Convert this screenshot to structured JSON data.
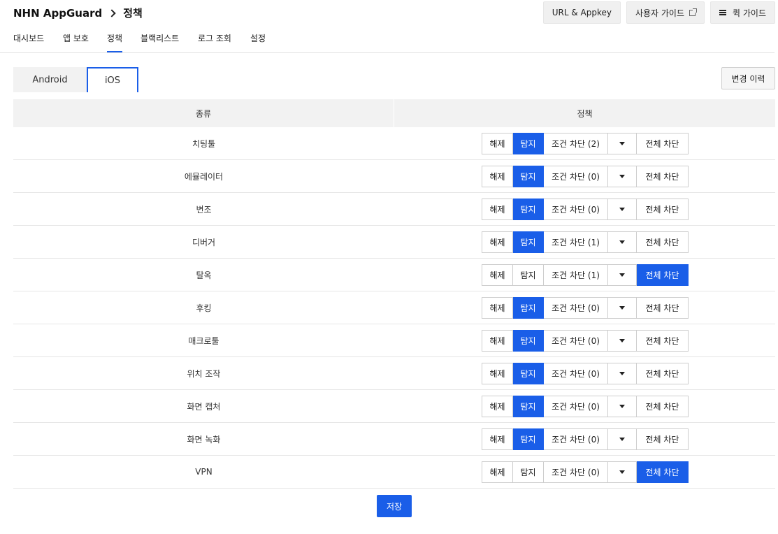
{
  "breadcrumb": {
    "app": "NHN AppGuard",
    "page": "정책"
  },
  "top_buttons": {
    "url_appkey": "URL & Appkey",
    "user_guide": "사용자 가이드",
    "quick_guide": "퀵 가이드"
  },
  "nav_tabs": [
    {
      "label": "대시보드",
      "active": false
    },
    {
      "label": "앱 보호",
      "active": false
    },
    {
      "label": "정책",
      "active": true
    },
    {
      "label": "블랙리스트",
      "active": false
    },
    {
      "label": "로그 조회",
      "active": false
    },
    {
      "label": "설정",
      "active": false
    }
  ],
  "os_tabs": [
    {
      "label": "Android",
      "active": false
    },
    {
      "label": "iOS",
      "active": true
    }
  ],
  "history_button": "변경 이력",
  "table": {
    "headers": {
      "type": "종류",
      "policy": "정책"
    },
    "segment_labels": {
      "release": "해제",
      "detect": "탐지",
      "full_block": "전체 차단"
    },
    "rows": [
      {
        "type": "치팅툴",
        "conditional": "조건 차단 (2)",
        "selected": "detect"
      },
      {
        "type": "에뮬레이터",
        "conditional": "조건 차단 (0)",
        "selected": "detect"
      },
      {
        "type": "변조",
        "conditional": "조건 차단 (0)",
        "selected": "detect"
      },
      {
        "type": "디버거",
        "conditional": "조건 차단 (1)",
        "selected": "detect"
      },
      {
        "type": "탈옥",
        "conditional": "조건 차단 (1)",
        "selected": "full_block"
      },
      {
        "type": "후킹",
        "conditional": "조건 차단 (0)",
        "selected": "detect"
      },
      {
        "type": "매크로툴",
        "conditional": "조건 차단 (0)",
        "selected": "detect"
      },
      {
        "type": "위치 조작",
        "conditional": "조건 차단 (0)",
        "selected": "detect"
      },
      {
        "type": "화면 캡처",
        "conditional": "조건 차단 (0)",
        "selected": "detect"
      },
      {
        "type": "화면 녹화",
        "conditional": "조건 차단 (0)",
        "selected": "detect"
      },
      {
        "type": "VPN",
        "conditional": "조건 차단 (0)",
        "selected": "full_block"
      }
    ]
  },
  "save_button": "저장",
  "colors": {
    "accent": "#1a5ee8",
    "header_bg": "#f2f2f2"
  }
}
